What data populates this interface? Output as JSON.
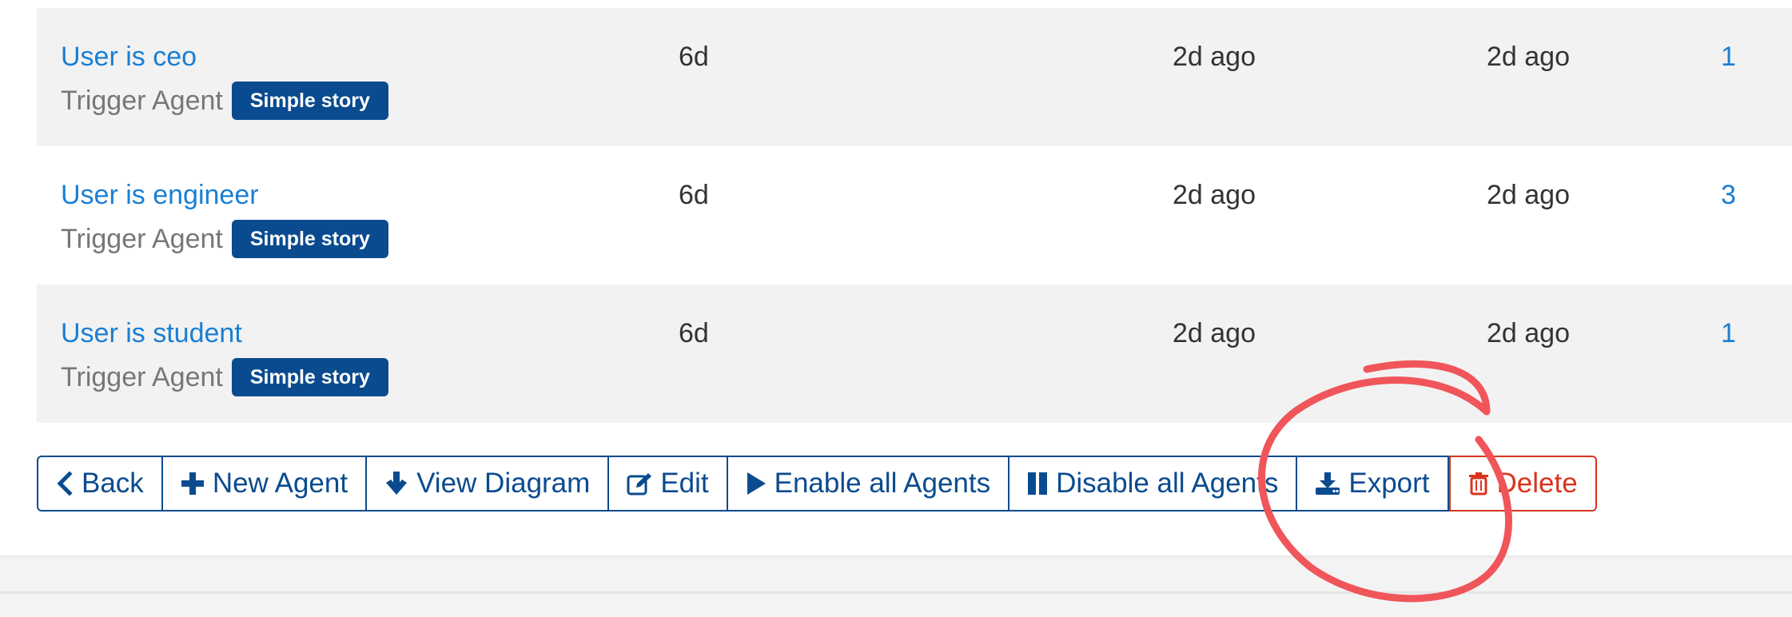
{
  "agents": [
    {
      "name": "User is ceo",
      "type": "Trigger Agent",
      "scenario": "Simple story",
      "age": "6d",
      "last_check": "2d ago",
      "last_event": "2d ago",
      "events": "1"
    },
    {
      "name": "User is engineer",
      "type": "Trigger Agent",
      "scenario": "Simple story",
      "age": "6d",
      "last_check": "2d ago",
      "last_event": "2d ago",
      "events": "3"
    },
    {
      "name": "User is student",
      "type": "Trigger Agent",
      "scenario": "Simple story",
      "age": "6d",
      "last_check": "2d ago",
      "last_event": "2d ago",
      "events": "1"
    }
  ],
  "toolbar": {
    "back": "Back",
    "new_agent": "New Agent",
    "view_diagram": "View Diagram",
    "edit": "Edit",
    "enable_all": "Enable all Agents",
    "disable_all": "Disable all Agents",
    "export": "Export",
    "delete": "Delete"
  },
  "icons": {
    "back": "chevron-left-icon",
    "new_agent": "plus-icon",
    "view_diagram": "arrow-down-icon",
    "edit": "edit-icon",
    "enable_all": "play-icon",
    "disable_all": "pause-icon",
    "export": "download-icon",
    "delete": "trash-icon"
  },
  "colors": {
    "link": "#1a7fd4",
    "primary": "#0a4b8f",
    "danger": "#d9341e",
    "annotation": "#f0555a"
  }
}
